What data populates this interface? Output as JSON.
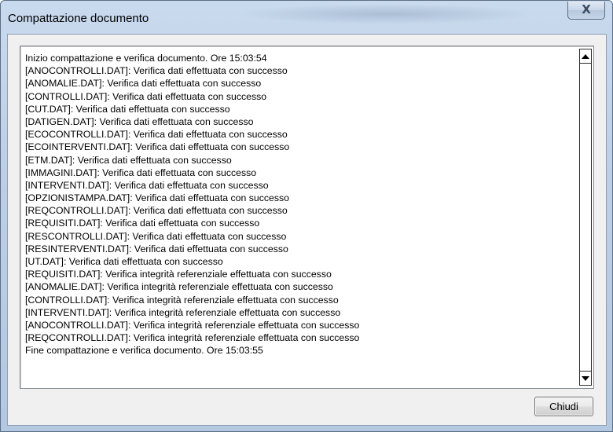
{
  "window": {
    "title": "Compattazione documento",
    "close_symbol": "X"
  },
  "log": {
    "lines": [
      "Inizio compattazione e verifica documento. Ore 15:03:54",
      "[ANOCONTROLLI.DAT]: Verifica dati effettuata con successo",
      "[ANOMALIE.DAT]: Verifica dati effettuata con successo",
      "[CONTROLLI.DAT]: Verifica dati effettuata con successo",
      "[CUT.DAT]: Verifica dati effettuata con successo",
      "[DATIGEN.DAT]: Verifica dati effettuata con successo",
      "[ECOCONTROLLI.DAT]: Verifica dati effettuata con successo",
      "[ECOINTERVENTI.DAT]: Verifica dati effettuata con successo",
      "[ETM.DAT]: Verifica dati effettuata con successo",
      "[IMMAGINI.DAT]: Verifica dati effettuata con successo",
      "[INTERVENTI.DAT]: Verifica dati effettuata con successo",
      "[OPZIONISTAMPA.DAT]: Verifica dati effettuata con successo",
      "[REQCONTROLLI.DAT]: Verifica dati effettuata con successo",
      "[REQUISITI.DAT]: Verifica dati effettuata con successo",
      "[RESCONTROLLI.DAT]: Verifica dati effettuata con successo",
      "[RESINTERVENTI.DAT]: Verifica dati effettuata con successo",
      "[UT.DAT]: Verifica dati effettuata con successo",
      "[REQUISITI.DAT]: Verifica integrità referenziale effettuata con successo",
      "[ANOMALIE.DAT]: Verifica integrità referenziale effettuata con successo",
      "[CONTROLLI.DAT]: Verifica integrità referenziale effettuata con successo",
      "[INTERVENTI.DAT]: Verifica integrità referenziale effettuata con successo",
      "[ANOCONTROLLI.DAT]: Verifica integrità referenziale effettuata con successo",
      "[REQCONTROLLI.DAT]: Verifica integrità referenziale effettuata con successo",
      "Fine compattazione e verifica documento. Ore 15:03:55"
    ]
  },
  "scrollbar": {
    "up_icon": "arrow-up-icon",
    "down_icon": "arrow-down-icon"
  },
  "buttons": {
    "close_label": "Chiudi"
  }
}
